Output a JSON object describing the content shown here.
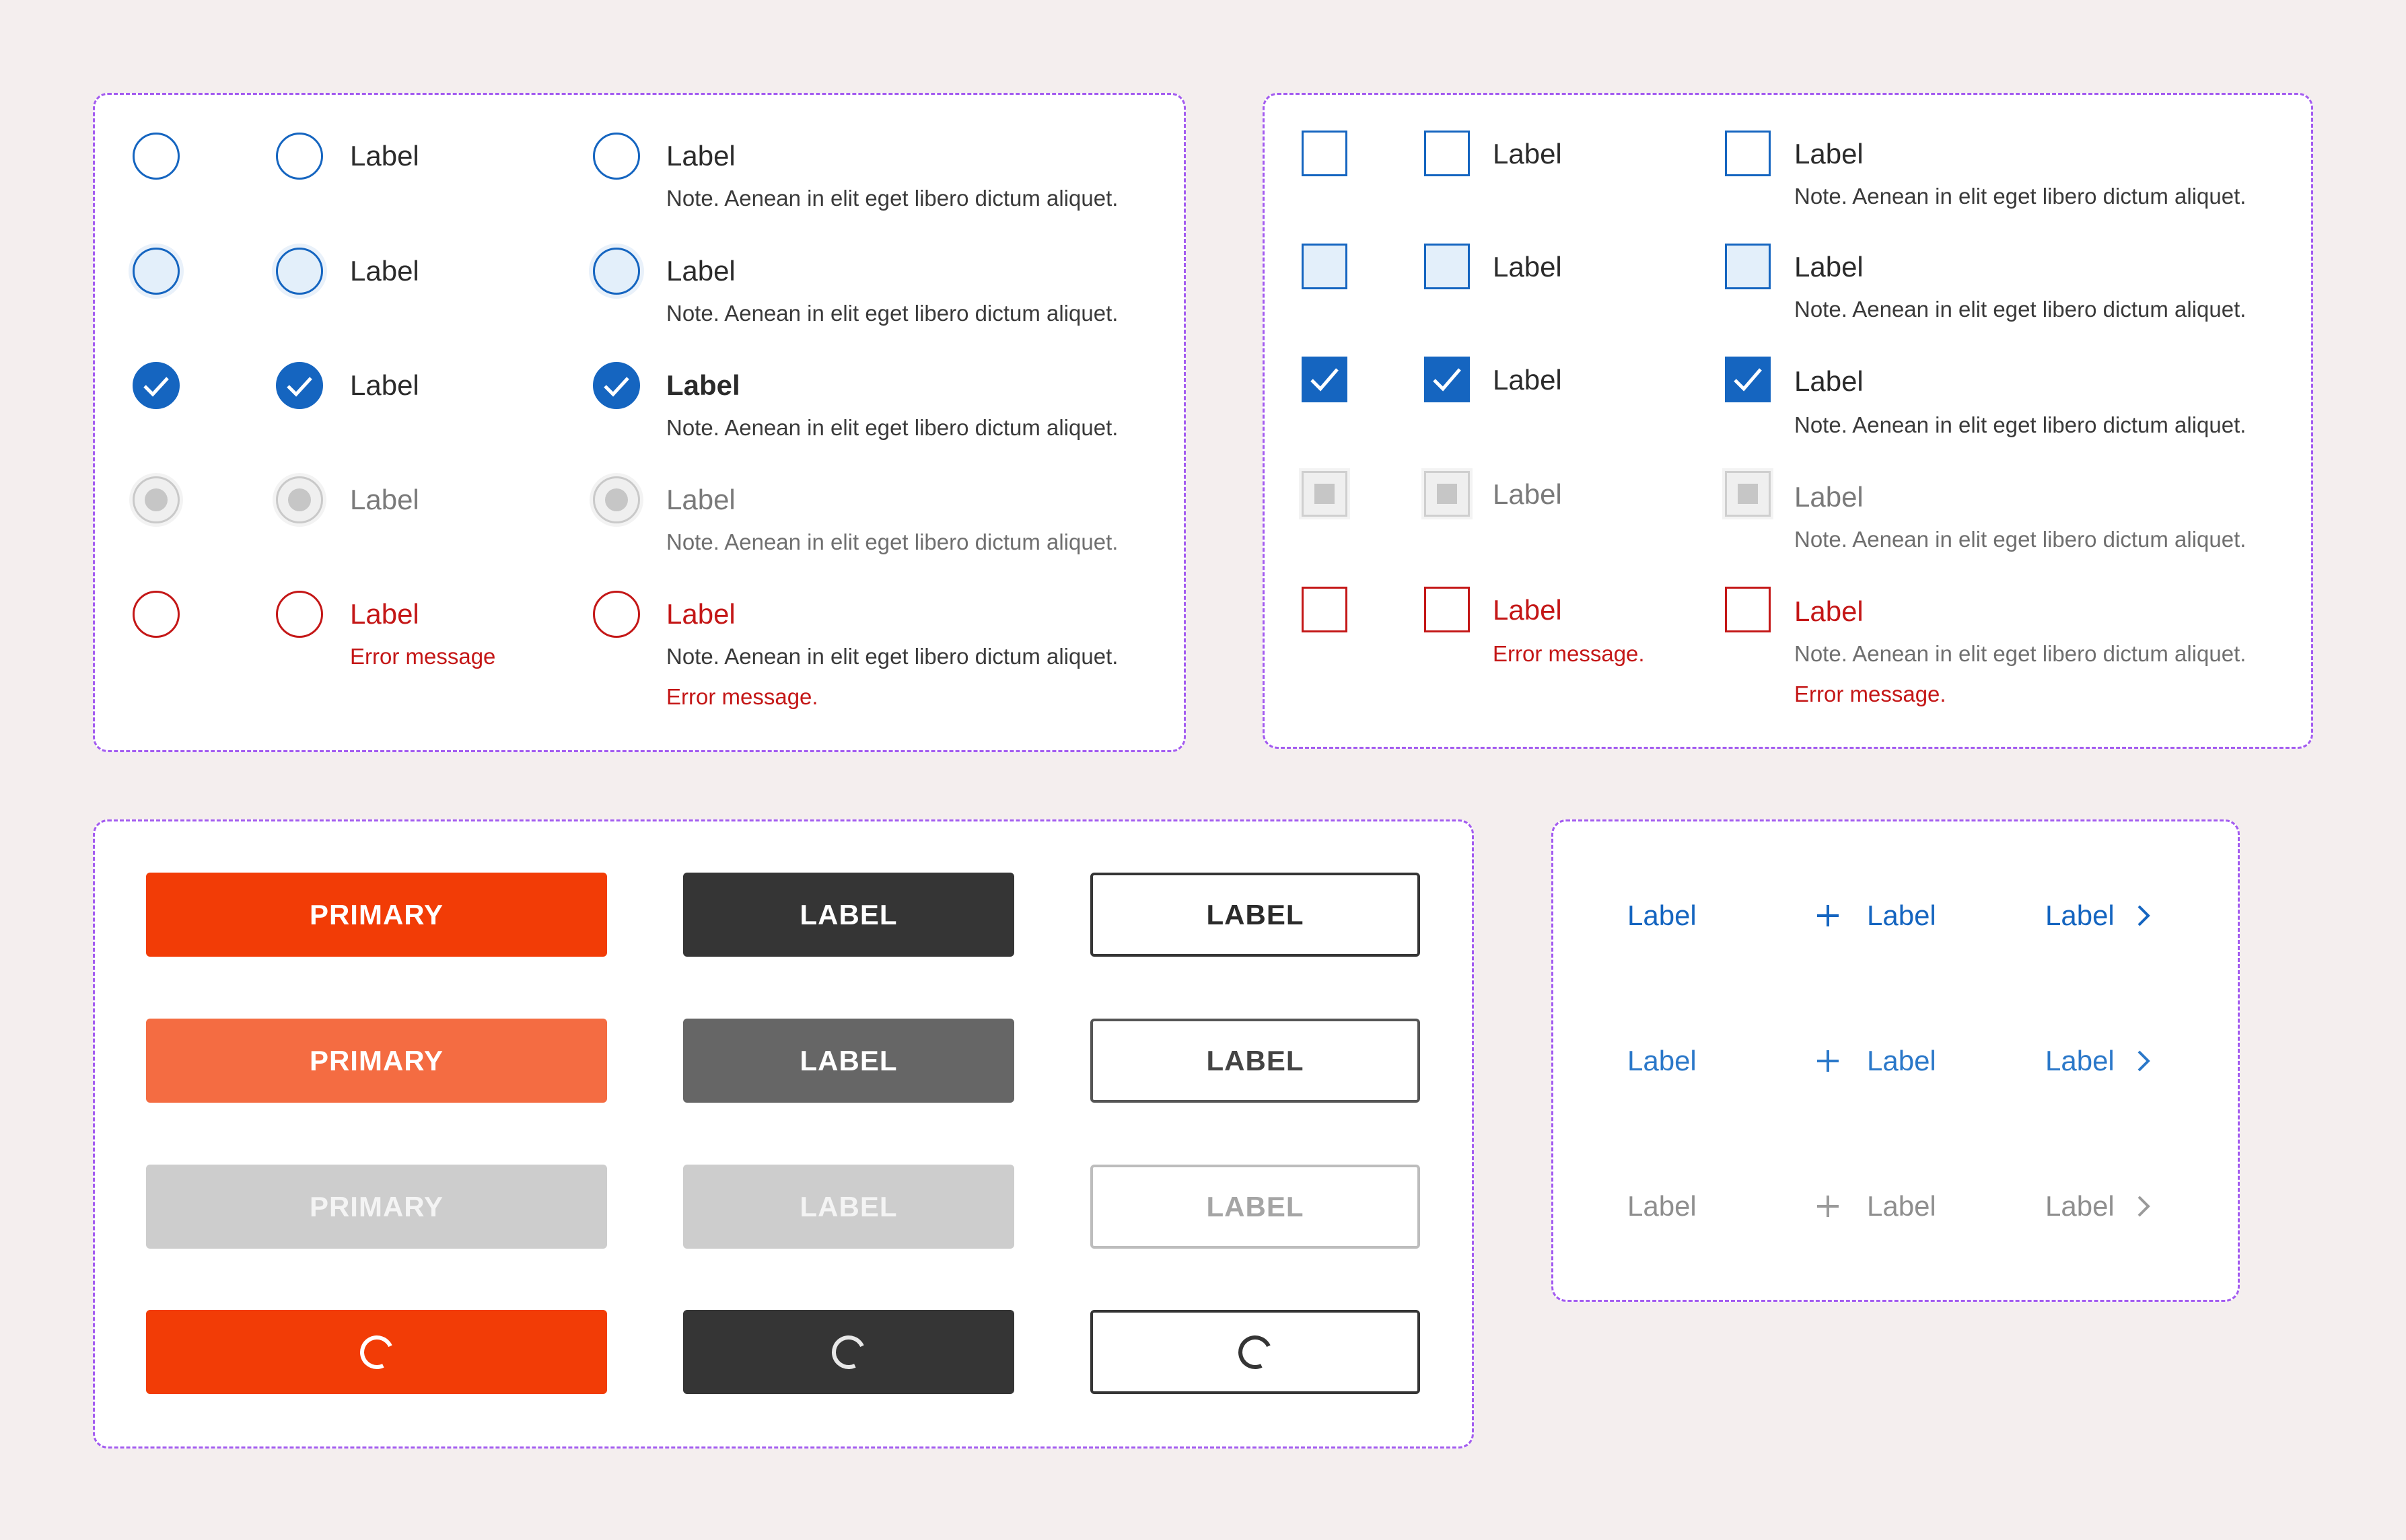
{
  "colors": {
    "background": "#f4eeee",
    "panel_border": "#a35bf0",
    "accent_blue": "#1565c0",
    "error_red": "#c41717",
    "primary_orange": "#f23c06",
    "primary_hover": "#f46c42",
    "dark": "#353535"
  },
  "radios": {
    "label": "Label",
    "note": "Note. Aenean in elit eget libero dictum aliquet.",
    "error_message_short": "Error message",
    "error_message_long": "Error message."
  },
  "checkboxes": {
    "label": "Label",
    "note": "Note. Aenean in elit eget libero dictum aliquet.",
    "error_message": "Error message."
  },
  "buttons": {
    "primary_label": "PRIMARY",
    "secondary_label": "LABEL",
    "outline_label": "LABEL",
    "states": [
      "default",
      "hover",
      "disabled",
      "loading"
    ]
  },
  "links": {
    "label": "Label",
    "plus_icon": "plus-icon",
    "chevron_icon": "chevron-right-icon"
  }
}
